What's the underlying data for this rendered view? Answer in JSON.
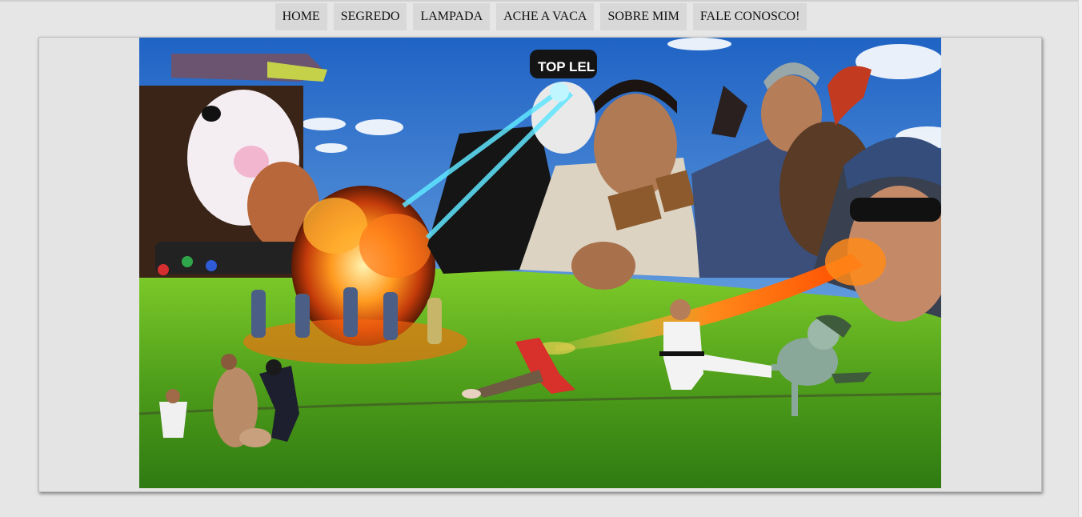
{
  "nav": {
    "items": [
      {
        "label": "HOME"
      },
      {
        "label": "SEGREDO"
      },
      {
        "label": "LAMPADA"
      },
      {
        "label": "ACHE A VACA"
      },
      {
        "label": "SOBRE MIM"
      },
      {
        "label": "FALE CONOSCO!"
      }
    ]
  },
  "banner": {
    "cap_text": "TOP LEL",
    "colors": {
      "sky_top": "#1f63c4",
      "sky_bottom": "#8fc1ee",
      "grass_light": "#7fcc2a",
      "grass_dark": "#2f7a12",
      "fire": "#ff8a1a",
      "beam": "#5fe6ff"
    }
  }
}
